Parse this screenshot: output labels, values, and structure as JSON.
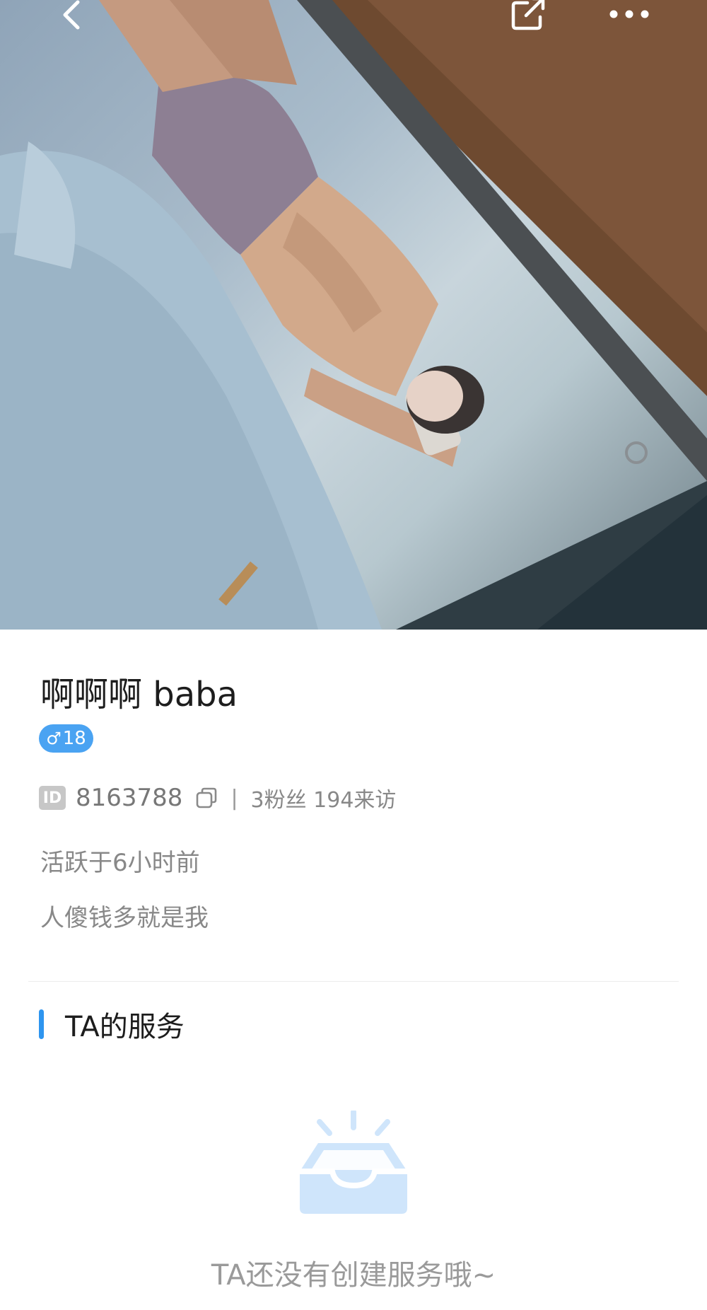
{
  "header": {
    "back_icon": "back-chevron-icon",
    "share_icon": "share-icon",
    "more_icon": "more-dots-icon"
  },
  "cover": {
    "image": "mirror-selfie-cover-photo"
  },
  "profile": {
    "name": "啊啊啊 baba",
    "gender_symbol": "♂",
    "age": "18",
    "id_label": "ID",
    "id_value": "8163788",
    "separator": "|",
    "stats": "3粉丝 194来访",
    "active": "活跃于6小时前",
    "bio": "人傻钱多就是我"
  },
  "services": {
    "title": "TA的服务",
    "empty_text": "TA还没有创建服务哦~"
  },
  "colors": {
    "accent": "#2e95ef",
    "badge": "#4aa3f2",
    "empty_icon": "#cfe5fb"
  }
}
